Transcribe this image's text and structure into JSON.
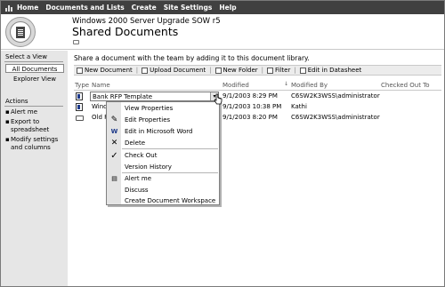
{
  "topnav": {
    "items": [
      "Home",
      "Documents and Lists",
      "Create",
      "Site Settings",
      "Help"
    ]
  },
  "header": {
    "site_title": "Windows 2000 Server Upgrade SOW r5",
    "page_title": "Shared Documents"
  },
  "leftnav": {
    "select_view_heading": "Select a View",
    "views": [
      "All Documents",
      "Explorer View"
    ],
    "actions_heading": "Actions",
    "actions": [
      "Alert me",
      "Export to spreadsheet",
      "Modify settings and columns"
    ]
  },
  "main": {
    "intro": "Share a document with the team by adding it to this document library.",
    "toolbar": [
      "New Document",
      "Upload Document",
      "New Folder",
      "Filter",
      "Edit in Datasheet"
    ],
    "columns": {
      "type": "Type",
      "name": "Name",
      "modified": "Modified",
      "modified_by": "Modified By",
      "checked_out_to": "Checked Out To"
    },
    "rows": [
      {
        "name": "Bank RFP Template",
        "modified": "9/1/2003 8:29 PM",
        "modified_by": "C6SW2K3WSS\\administrator",
        "icon": "word-doc-icon"
      },
      {
        "name": "Wind",
        "modified": "9/1/2003 10:38 PM",
        "modified_by": "Kathi",
        "icon": "word-doc-icon"
      },
      {
        "name": "Old R",
        "modified": "9/1/2003 8:20 PM",
        "modified_by": "C6SW2K3WSS\\administrator",
        "icon": "folder-icon"
      }
    ]
  },
  "context_menu": {
    "items": [
      {
        "label": "View Properties",
        "icon": ""
      },
      {
        "label": "Edit Properties",
        "icon": "edit-properties-icon"
      },
      {
        "label": "Edit in Microsoft Word",
        "icon": "word-icon"
      },
      {
        "label": "Delete",
        "icon": "delete-x-icon"
      },
      {
        "label": "Check Out",
        "icon": "checkmark-icon"
      },
      {
        "label": "Version History",
        "icon": ""
      },
      {
        "label": "Alert me",
        "icon": "alert-icon"
      },
      {
        "label": "Discuss",
        "icon": ""
      },
      {
        "label": "Create Document Workspace",
        "icon": ""
      }
    ]
  },
  "colors": {
    "topbar": "#404040",
    "leftnav": "#e6e6e6",
    "toolbar": "#ececec",
    "menu_gutter": "#e4e4e4"
  }
}
